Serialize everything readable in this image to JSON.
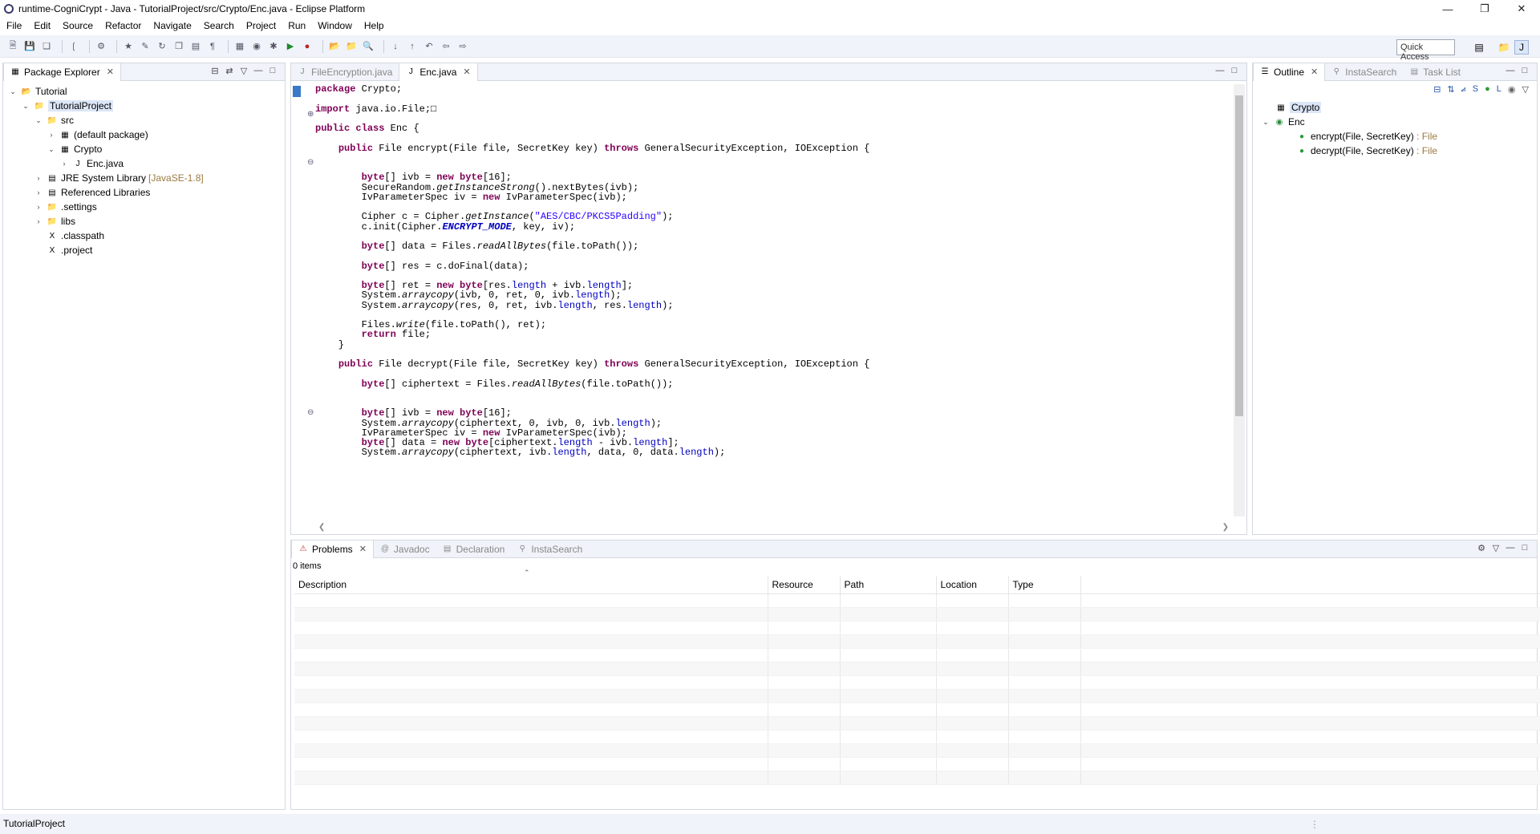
{
  "window": {
    "title": "runtime-CogniCrypt - Java - TutorialProject/src/Crypto/Enc.java - Eclipse Platform"
  },
  "menu": [
    "File",
    "Edit",
    "Source",
    "Refactor",
    "Navigate",
    "Search",
    "Project",
    "Run",
    "Window",
    "Help"
  ],
  "toolbar": {
    "quick_access": "Quick Access"
  },
  "package_explorer": {
    "tab": "Package Explorer",
    "tree": [
      {
        "label": "Tutorial",
        "depth": 0,
        "icon": "project-icon",
        "arrow": "v",
        "suffix": ""
      },
      {
        "label": "TutorialProject",
        "depth": 1,
        "icon": "project-folder-icon",
        "arrow": "v",
        "suffix": "",
        "selected": true
      },
      {
        "label": "src",
        "depth": 2,
        "icon": "source-folder-icon",
        "arrow": "v",
        "suffix": ""
      },
      {
        "label": "(default package)",
        "depth": 3,
        "icon": "package-icon",
        "arrow": ">",
        "suffix": ""
      },
      {
        "label": "Crypto",
        "depth": 3,
        "icon": "package-icon",
        "arrow": "v",
        "suffix": ""
      },
      {
        "label": "Enc.java",
        "depth": 4,
        "icon": "java-file-icon",
        "arrow": ">",
        "suffix": ""
      },
      {
        "label": "JRE System Library",
        "depth": 2,
        "icon": "library-icon",
        "arrow": ">",
        "suffix": "[JavaSE-1.8]"
      },
      {
        "label": "Referenced Libraries",
        "depth": 2,
        "icon": "library-icon",
        "arrow": ">",
        "suffix": ""
      },
      {
        "label": ".settings",
        "depth": 2,
        "icon": "folder-icon",
        "arrow": ">",
        "suffix": ""
      },
      {
        "label": "libs",
        "depth": 2,
        "icon": "folder-icon",
        "arrow": ">",
        "suffix": ""
      },
      {
        "label": ".classpath",
        "depth": 2,
        "icon": "xml-file-icon",
        "arrow": "",
        "suffix": ""
      },
      {
        "label": ".project",
        "depth": 2,
        "icon": "xml-file-icon",
        "arrow": "",
        "suffix": ""
      }
    ]
  },
  "editor": {
    "tabs": [
      {
        "label": "FileEncryption.java",
        "active": false
      },
      {
        "label": "Enc.java",
        "active": true
      }
    ]
  },
  "outline": {
    "tabs": [
      "Outline",
      "InstaSearch",
      "Task List"
    ],
    "items": [
      {
        "label": "Crypto",
        "type": "",
        "depth": 0
      },
      {
        "label": "Enc",
        "type": "",
        "depth": 0
      },
      {
        "label": "encrypt(File, SecretKey)",
        "type": " : File",
        "depth": 1
      },
      {
        "label": "decrypt(File, SecretKey)",
        "type": " : File",
        "depth": 1
      }
    ]
  },
  "bottom": {
    "tabs": [
      "Problems",
      "Javadoc",
      "Declaration",
      "InstaSearch"
    ],
    "count": "0 items",
    "columns": [
      "Description",
      "Resource",
      "Path",
      "Location",
      "Type"
    ]
  },
  "status": {
    "text": "TutorialProject"
  }
}
